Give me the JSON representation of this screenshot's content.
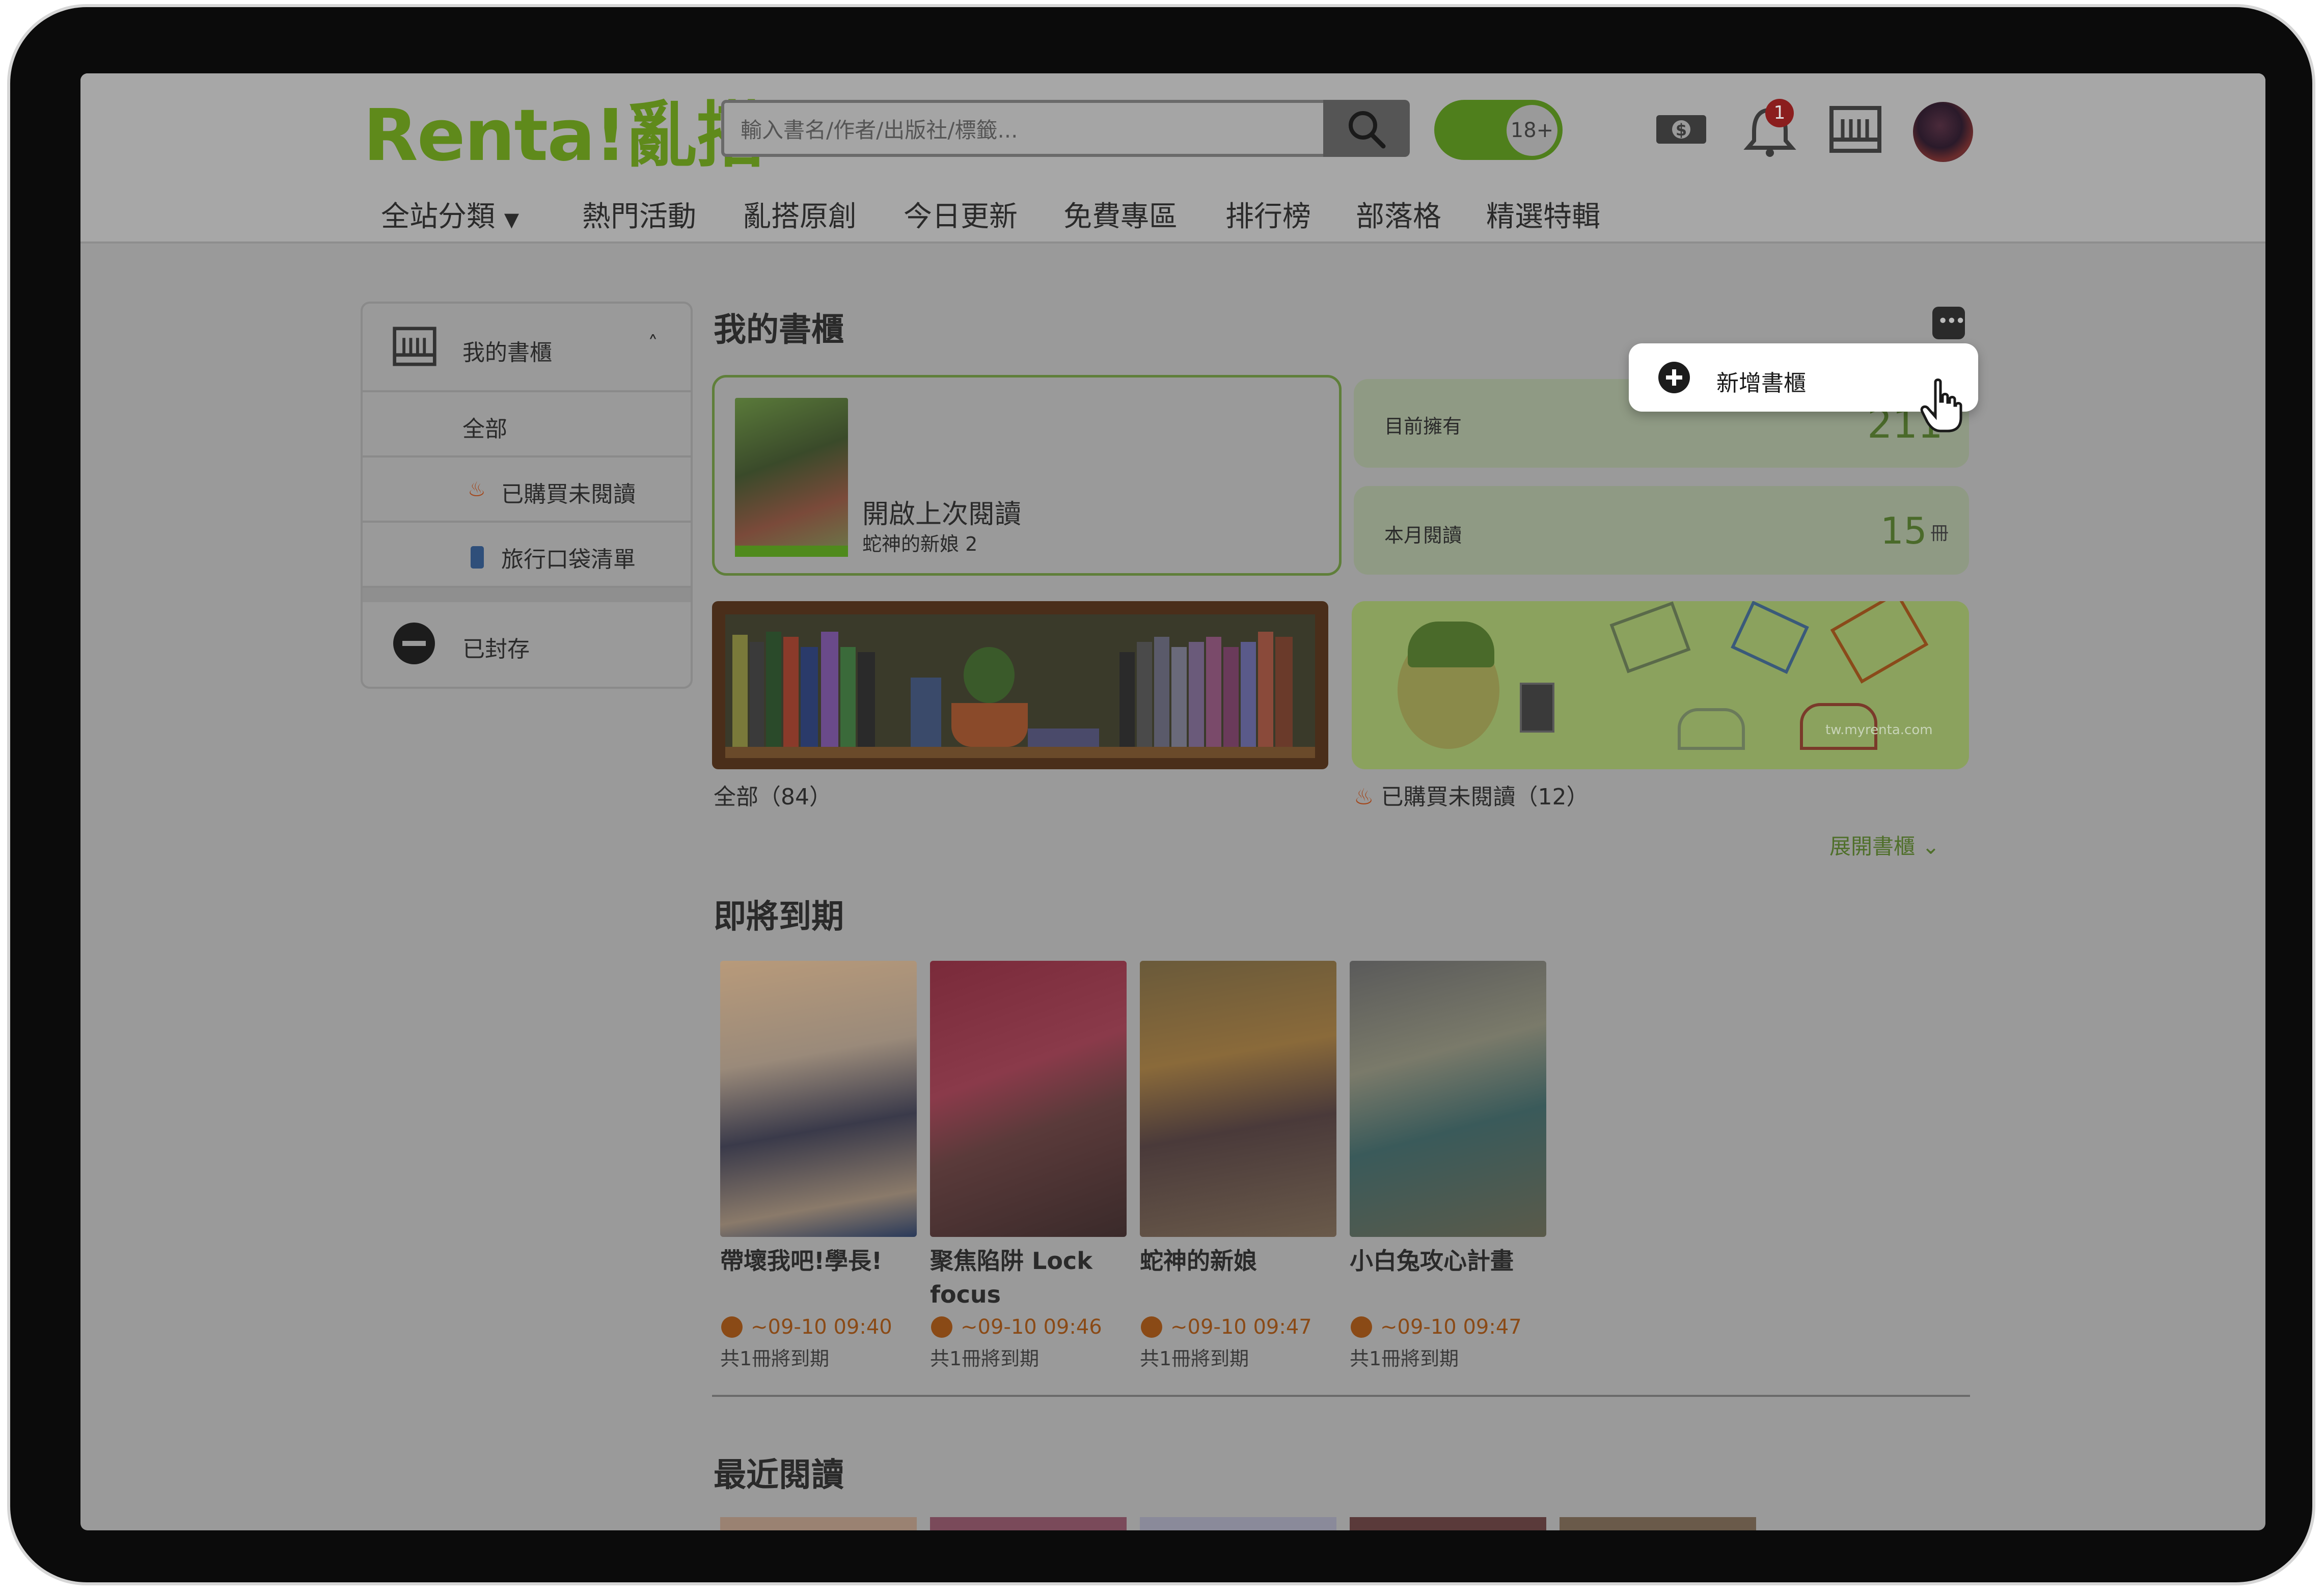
{
  "header": {
    "logo": "Renta!亂搭",
    "search_placeholder": "輸入書名/作者/出版社/標籤...",
    "age_toggle": "18+",
    "notification_count": "1"
  },
  "nav": {
    "categories": "全站分類",
    "events": "熱門活動",
    "original": "亂搭原創",
    "today": "今日更新",
    "free": "免費專區",
    "ranking": "排行榜",
    "blog": "部落格",
    "featured": "精選特輯"
  },
  "sidebar": {
    "title": "我的書櫃",
    "all": "全部",
    "unread": "已購買未閱讀",
    "travel": "旅行口袋清單",
    "archived": "已封存"
  },
  "main": {
    "title": "我的書櫃",
    "popup_label": "新增書櫃",
    "last_read_label": "開啟上次閱讀",
    "last_read_book": "蛇神的新娘 2",
    "owned_label": "目前擁有",
    "owned_value": "211",
    "month_label": "本月閱讀",
    "month_value": "15",
    "month_unit": "冊",
    "shelf_all": "全部（84）",
    "shelf_unread": "已購買未閱讀（12）",
    "banner_url": "tw.myrenta.com",
    "expand": "展開書櫃"
  },
  "expiring": {
    "title": "即將到期",
    "books": [
      {
        "title": "帶壞我吧!學長!",
        "date": "~09-10 09:40",
        "note": "共1冊將到期"
      },
      {
        "title": "聚焦陷阱 Lock focus",
        "date": "~09-10 09:46",
        "note": "共1冊將到期"
      },
      {
        "title": "蛇神的新娘",
        "date": "~09-10 09:47",
        "note": "共1冊將到期"
      },
      {
        "title": "小白兔攻心計畫",
        "date": "~09-10 09:47",
        "note": "共1冊將到期"
      }
    ]
  },
  "recent": {
    "title": "最近閱讀"
  },
  "colors": {
    "accent": "#5f8a1b",
    "overlay": "#9a9a9a",
    "expire": "#8a4a16"
  }
}
